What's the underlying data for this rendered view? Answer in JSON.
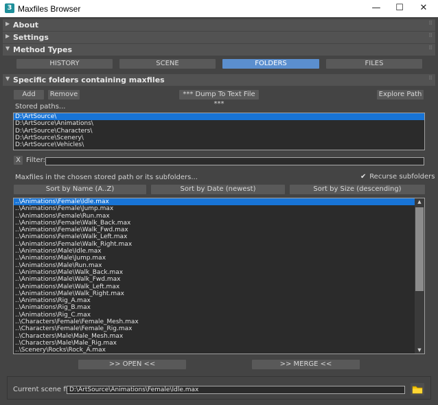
{
  "window": {
    "title": "Maxfiles Browser",
    "app_icon_glyph": "3",
    "minimize_glyph": "—",
    "maximize_glyph": "☐",
    "close_glyph": "✕"
  },
  "rollouts": {
    "about": "About",
    "settings": "Settings",
    "method_types": "Method Types",
    "specific_folders": "Specific folders containing maxfiles"
  },
  "method_tabs": [
    "HISTORY",
    "SCENE",
    "FOLDERS",
    "FILES"
  ],
  "method_active": "FOLDERS",
  "folder_buttons": {
    "add": "Add",
    "remove": "Remove",
    "dump": "***  Dump To Text File  ***",
    "explore": "Explore Path"
  },
  "stored_paths_label": "Stored paths...",
  "stored_paths": [
    "D:\\ArtSource\\",
    "D:\\ArtSource\\Animations\\",
    "D:\\ArtSource\\Characters\\",
    "D:\\ArtSource\\Scenery\\",
    "D:\\ArtSource\\Vehicles\\"
  ],
  "filter": {
    "clear_label": "X",
    "label": "Filter:",
    "value": ""
  },
  "maxfiles_label": "Maxfiles in the chosen stored path or its subfolders...",
  "recurse_label": "Recurse subfolders",
  "recurse_checked": true,
  "sort_buttons": {
    "by_name": "Sort by Name (A..Z)",
    "by_date": "Sort by Date (newest)",
    "by_size": "Sort by Size (descending)"
  },
  "maxfiles": [
    "..\\Animations\\Female\\Idle.max",
    "..\\Animations\\Female\\Jump.max",
    "..\\Animations\\Female\\Run.max",
    "..\\Animations\\Female\\Walk_Back.max",
    "..\\Animations\\Female\\Walk_Fwd.max",
    "..\\Animations\\Female\\Walk_Left.max",
    "..\\Animations\\Female\\Walk_Right.max",
    "..\\Animations\\Male\\Idle.max",
    "..\\Animations\\Male\\Jump.max",
    "..\\Animations\\Male\\Run.max",
    "..\\Animations\\Male\\Walk_Back.max",
    "..\\Animations\\Male\\Walk_Fwd.max",
    "..\\Animations\\Male\\Walk_Left.max",
    "..\\Animations\\Male\\Walk_Right.max",
    "..\\Animations\\Rig_A.max",
    "..\\Animations\\Rig_B.max",
    "..\\Animations\\Rig_C.max",
    "..\\Characters\\Female\\Female_Mesh.max",
    "..\\Characters\\Female\\Female_Rig.max",
    "..\\Characters\\Male\\Male_Mesh.max",
    "..\\Characters\\Male\\Male_Rig.max",
    "..\\Scenery\\Rocks\\Rock_A.max"
  ],
  "action_buttons": {
    "open": ">>   OPEN   <<",
    "merge": ">>   MERGE   <<"
  },
  "current_scene": {
    "label": "Current scene file:",
    "value": "D:\\ArtSource\\Animations\\Female\\Idle.max"
  },
  "icons": {
    "folder": "folder-icon",
    "checkbox": "checkbox-icon",
    "collapse_arrow": "collapse-arrow-icon",
    "expand_arrow": "expand-arrow-icon"
  },
  "colors": {
    "selection": "#1874d6",
    "active_tab": "#5b8fcf",
    "folder_icon": "#f2c200"
  }
}
